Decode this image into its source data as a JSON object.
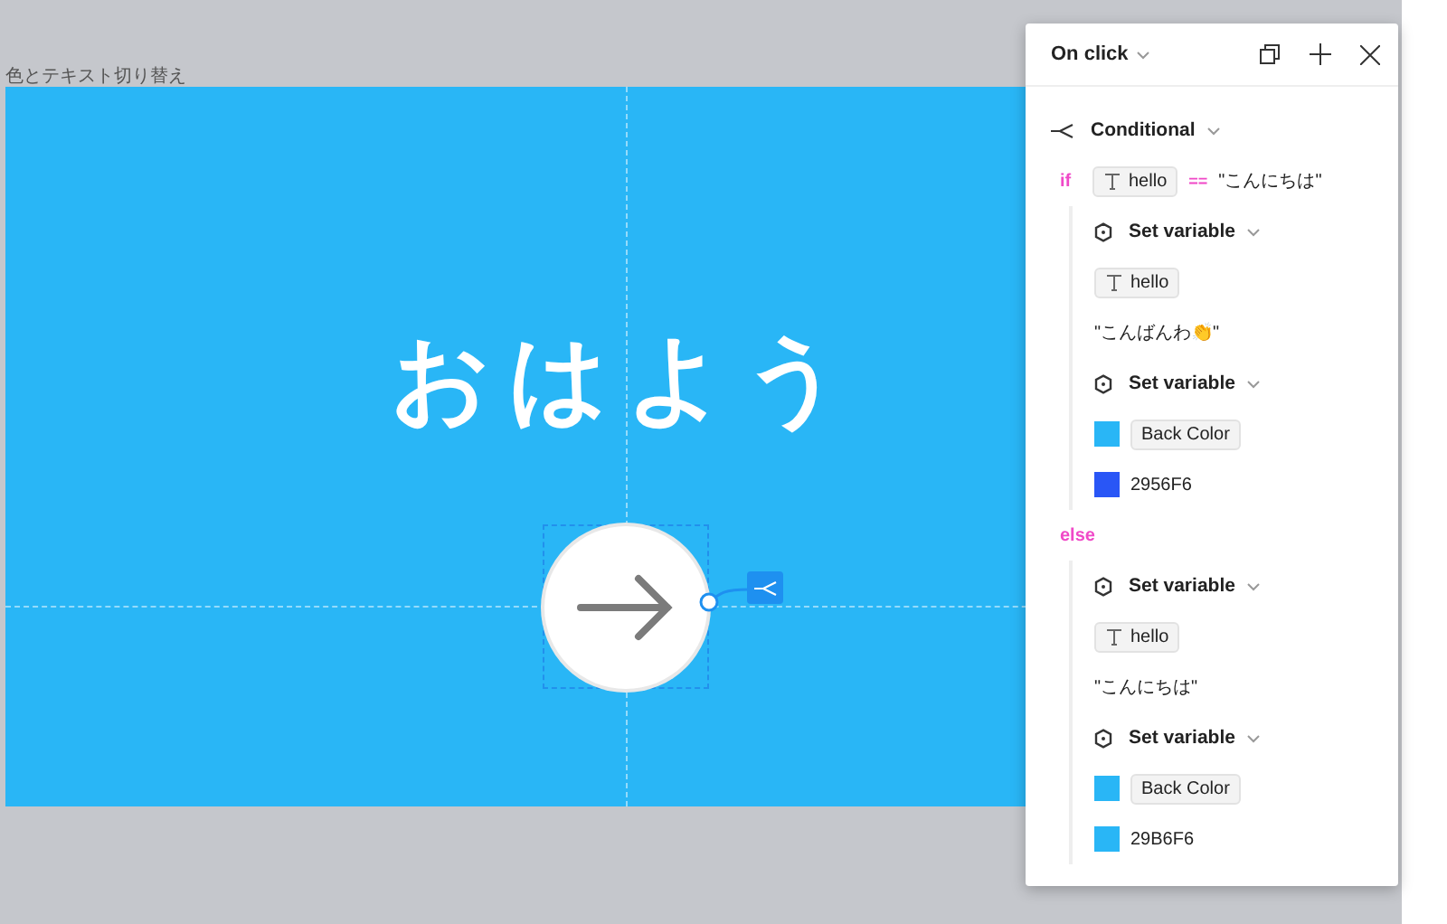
{
  "canvas": {
    "frame_label": "色とテキスト切り替え",
    "frame_text": "おはよう"
  },
  "panel": {
    "trigger": "On click",
    "action": "Conditional",
    "branches": [
      {
        "keyword": "if",
        "condition": {
          "variable": "hello",
          "operator": "==",
          "value": "\"こんにちは\""
        },
        "actions": [
          {
            "title": "Set variable",
            "target": {
              "kind": "text",
              "name": "hello"
            },
            "value": {
              "kind": "text",
              "text": "\"こんばんわ👏\""
            }
          },
          {
            "title": "Set variable",
            "target": {
              "kind": "color",
              "name": "Back Color",
              "color": "#29b6f6"
            },
            "value": {
              "kind": "color",
              "text": "2956F6",
              "color": "#2956f6"
            }
          }
        ]
      },
      {
        "keyword": "else",
        "actions": [
          {
            "title": "Set variable",
            "target": {
              "kind": "text",
              "name": "hello"
            },
            "value": {
              "kind": "text",
              "text": "\"こんにちは\""
            }
          },
          {
            "title": "Set variable",
            "target": {
              "kind": "color",
              "name": "Back Color",
              "color": "#29b6f6"
            },
            "value": {
              "kind": "color",
              "text": "29B6F6",
              "color": "#29b6f6"
            }
          }
        ]
      }
    ]
  }
}
